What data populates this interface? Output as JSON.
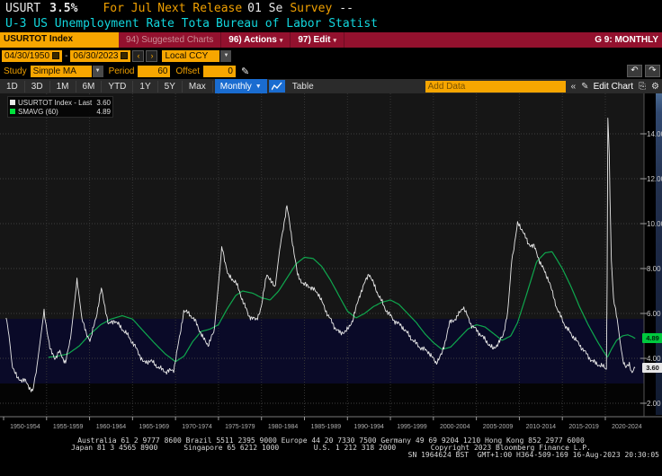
{
  "colors": {
    "amber": "#f7a600",
    "amber_text": "#f0a000",
    "redbar": "#93112e",
    "blue": "#1a6cd0",
    "cyan": "#12d7de",
    "green": "#0fa84e",
    "greenbadge": "#00c93e",
    "white_line": "#e8e8e8",
    "plot_bg": "#161616",
    "band_bg": "#0a0a28",
    "below_bg": "#040404",
    "grid": "#3f3f3f",
    "toolbar": "#2b2b2b"
  },
  "header": {
    "ticker": "USURT",
    "value": "3.5%",
    "for_label": "For Jul",
    "next_release_label": "Next Release",
    "next_release_value": "01 Se",
    "survey_label": "Survey",
    "survey_value": "--",
    "name": "U-3 US Unemployment Rate Tota",
    "source": "Bureau of Labor Statist"
  },
  "titlebar": {
    "security": "USURTOT Index",
    "suggested": "94) Suggested Charts",
    "actions": "96) Actions",
    "edit": "97) Edit",
    "right": "G 9: MONTHLY"
  },
  "controls": {
    "date_from": "04/30/1950",
    "date_sep": "-",
    "date_to": "06/30/2023",
    "prev": "‹",
    "next": "›",
    "ccy": "Local CCY",
    "study_label": "Study",
    "study_value": "Simple MA",
    "period_label": "Period",
    "period_value": "60",
    "offset_label": "Offset",
    "offset_value": "0",
    "undo": "↶",
    "redo": "↷"
  },
  "toolbar": {
    "tabs": [
      "1D",
      "3D",
      "1M",
      "6M",
      "YTD",
      "1Y",
      "5Y",
      "Max"
    ],
    "frequency": "Monthly",
    "table_label": "Table",
    "add_data": "Add Data",
    "collapse": "«",
    "edit_chart": "Edit Chart"
  },
  "legend": {
    "items": [
      {
        "label": "USURTOT Index - Last Price",
        "value": "3.60",
        "color": "#e8e8e8"
      },
      {
        "label": "SMAVG (60)",
        "value": "4.89",
        "color": "#00e13c"
      }
    ]
  },
  "badges": {
    "smavg": "4.89",
    "last": "3.60"
  },
  "footer": {
    "line1": "Australia 61 2 9777 8600 Brazil 5511 2395 9000 Europe 44 20 7330 7500 Germany 49 69 9204 1210 Hong Kong 852 2977 6000",
    "line2": "Japan 81 3 4565 8900      Singapore 65 6212 1000        U.S. 1 212 318 2000        Copyright 2023 Bloomberg Finance L.P.",
    "line3": "SN 1964624 BST  GMT+1:00 H364-509-169 16-Aug-2023 20:30:05"
  },
  "chart_data": {
    "type": "line",
    "x_range": [
      1950,
      2024.5
    ],
    "ylim": [
      1.4,
      15.8
    ],
    "y_ticks": [
      2,
      4,
      6,
      8,
      10,
      12,
      14
    ],
    "x_gridlines": [
      1955,
      1960,
      1965,
      1970,
      1975,
      1980,
      1985,
      1990,
      1995,
      2000,
      2005,
      2010,
      2015,
      2020
    ],
    "x_ticks": [
      1950,
      1955,
      1960,
      1965,
      1970,
      1975,
      1980,
      1985,
      1990,
      1995,
      2000,
      2005,
      2010,
      2015,
      2020
    ],
    "x_labels": [
      "1950-1954",
      "1955-1959",
      "1960-1964",
      "1965-1969",
      "1970-1974",
      "1975-1979",
      "1980-1984",
      "1985-1989",
      "1990-1994",
      "1995-1999",
      "2000-2004",
      "2005-2009",
      "2010-2014",
      "2015-2019",
      "2020-2024"
    ],
    "band": {
      "from": 2.88,
      "to": 5.76
    },
    "series": [
      {
        "name": "USURTOT Index - Last Price",
        "color": "#e8e8e8",
        "last_value": 3.6,
        "points": [
          [
            1950.29,
            5.8
          ],
          [
            1950.6,
            5.1
          ],
          [
            1951.0,
            3.7
          ],
          [
            1951.6,
            3.1
          ],
          [
            1952.5,
            3.0
          ],
          [
            1953.4,
            2.5
          ],
          [
            1953.9,
            3.7
          ],
          [
            1954.7,
            6.1
          ],
          [
            1955.4,
            4.4
          ],
          [
            1956.0,
            4.0
          ],
          [
            1956.5,
            4.3
          ],
          [
            1957.2,
            3.8
          ],
          [
            1957.8,
            4.9
          ],
          [
            1958.55,
            7.5
          ],
          [
            1959.1,
            5.8
          ],
          [
            1959.6,
            5.1
          ],
          [
            1960.1,
            4.8
          ],
          [
            1960.8,
            5.9
          ],
          [
            1961.37,
            7.1
          ],
          [
            1962.2,
            5.5
          ],
          [
            1962.9,
            5.7
          ],
          [
            1963.6,
            5.4
          ],
          [
            1964.5,
            5.0
          ],
          [
            1965.5,
            4.4
          ],
          [
            1966.3,
            3.8
          ],
          [
            1967.1,
            3.9
          ],
          [
            1968.0,
            3.6
          ],
          [
            1968.9,
            3.4
          ],
          [
            1969.8,
            3.5
          ],
          [
            1970.5,
            5.0
          ],
          [
            1970.95,
            6.1
          ],
          [
            1971.6,
            6.0
          ],
          [
            1972.4,
            5.6
          ],
          [
            1973.2,
            4.9
          ],
          [
            1973.8,
            4.6
          ],
          [
            1974.5,
            5.2
          ],
          [
            1975.4,
            9.0
          ],
          [
            1976.1,
            7.7
          ],
          [
            1977.0,
            7.4
          ],
          [
            1977.8,
            6.6
          ],
          [
            1978.5,
            5.9
          ],
          [
            1979.4,
            5.7
          ],
          [
            1980.0,
            6.3
          ],
          [
            1980.6,
            7.8
          ],
          [
            1981.1,
            7.4
          ],
          [
            1981.6,
            7.2
          ],
          [
            1982.1,
            8.8
          ],
          [
            1982.95,
            10.8
          ],
          [
            1983.6,
            9.2
          ],
          [
            1984.2,
            7.7
          ],
          [
            1984.9,
            7.3
          ],
          [
            1985.6,
            7.2
          ],
          [
            1986.6,
            6.9
          ],
          [
            1987.5,
            6.1
          ],
          [
            1988.5,
            5.4
          ],
          [
            1989.2,
            5.1
          ],
          [
            1990.1,
            5.3
          ],
          [
            1990.6,
            5.7
          ],
          [
            1991.5,
            6.9
          ],
          [
            1992.5,
            7.8
          ],
          [
            1993.4,
            7.0
          ],
          [
            1994.4,
            6.2
          ],
          [
            1995.4,
            5.7
          ],
          [
            1996.4,
            5.4
          ],
          [
            1997.4,
            4.9
          ],
          [
            1998.4,
            4.5
          ],
          [
            1999.4,
            4.3
          ],
          [
            2000.3,
            3.8
          ],
          [
            2001.0,
            4.2
          ],
          [
            2001.9,
            5.6
          ],
          [
            2002.7,
            5.8
          ],
          [
            2003.45,
            6.3
          ],
          [
            2004.4,
            5.5
          ],
          [
            2005.4,
            5.1
          ],
          [
            2006.3,
            4.7
          ],
          [
            2006.95,
            4.4
          ],
          [
            2007.6,
            4.7
          ],
          [
            2008.1,
            5.0
          ],
          [
            2008.65,
            6.1
          ],
          [
            2009.1,
            8.3
          ],
          [
            2009.8,
            10.0
          ],
          [
            2010.4,
            9.7
          ],
          [
            2011.0,
            9.1
          ],
          [
            2011.7,
            9.0
          ],
          [
            2012.5,
            8.2
          ],
          [
            2013.4,
            7.5
          ],
          [
            2014.4,
            6.2
          ],
          [
            2015.4,
            5.4
          ],
          [
            2016.4,
            4.9
          ],
          [
            2017.4,
            4.4
          ],
          [
            2018.4,
            3.9
          ],
          [
            2019.3,
            3.7
          ],
          [
            2019.9,
            3.6
          ],
          [
            2020.16,
            3.5
          ],
          [
            2020.29,
            14.7
          ],
          [
            2020.45,
            13.2
          ],
          [
            2020.54,
            11.1
          ],
          [
            2020.7,
            8.4
          ],
          [
            2020.95,
            6.7
          ],
          [
            2021.3,
            6.0
          ],
          [
            2021.7,
            4.8
          ],
          [
            2022.0,
            4.0
          ],
          [
            2022.4,
            3.6
          ],
          [
            2022.8,
            3.7
          ],
          [
            2023.05,
            3.4
          ],
          [
            2023.25,
            3.5
          ],
          [
            2023.45,
            3.6
          ]
        ]
      },
      {
        "name": "SMAVG (60)",
        "color": "#0fa84e",
        "last_value": 4.89,
        "points": [
          [
            1955.2,
            4.05
          ],
          [
            1956.3,
            4.1
          ],
          [
            1957.5,
            4.2
          ],
          [
            1958.8,
            4.55
          ],
          [
            1960.0,
            5.05
          ],
          [
            1961.3,
            5.5
          ],
          [
            1962.5,
            5.75
          ],
          [
            1963.8,
            5.9
          ],
          [
            1965.0,
            5.75
          ],
          [
            1966.3,
            5.2
          ],
          [
            1967.5,
            4.7
          ],
          [
            1968.8,
            4.2
          ],
          [
            1970.0,
            3.85
          ],
          [
            1971.0,
            4.1
          ],
          [
            1972.0,
            4.75
          ],
          [
            1973.0,
            5.2
          ],
          [
            1974.0,
            5.3
          ],
          [
            1975.0,
            5.5
          ],
          [
            1976.0,
            6.2
          ],
          [
            1977.0,
            6.8
          ],
          [
            1977.8,
            7.0
          ],
          [
            1979.0,
            6.9
          ],
          [
            1980.0,
            6.7
          ],
          [
            1981.0,
            6.6
          ],
          [
            1982.0,
            7.0
          ],
          [
            1983.0,
            7.6
          ],
          [
            1984.0,
            8.2
          ],
          [
            1985.0,
            8.5
          ],
          [
            1986.0,
            8.45
          ],
          [
            1987.0,
            8.1
          ],
          [
            1988.0,
            7.5
          ],
          [
            1989.0,
            6.8
          ],
          [
            1990.0,
            6.1
          ],
          [
            1991.0,
            5.8
          ],
          [
            1992.0,
            6.0
          ],
          [
            1993.0,
            6.3
          ],
          [
            1994.0,
            6.5
          ],
          [
            1995.0,
            6.6
          ],
          [
            1996.0,
            6.4
          ],
          [
            1997.0,
            6.0
          ],
          [
            1998.0,
            5.6
          ],
          [
            1999.0,
            5.1
          ],
          [
            2000.0,
            4.7
          ],
          [
            2001.0,
            4.4
          ],
          [
            2002.0,
            4.5
          ],
          [
            2003.0,
            4.9
          ],
          [
            2004.0,
            5.3
          ],
          [
            2005.0,
            5.5
          ],
          [
            2006.0,
            5.4
          ],
          [
            2007.0,
            5.1
          ],
          [
            2008.0,
            4.8
          ],
          [
            2009.0,
            5.0
          ],
          [
            2009.8,
            5.6
          ],
          [
            2010.8,
            6.8
          ],
          [
            2012.0,
            8.3
          ],
          [
            2013.0,
            8.7
          ],
          [
            2013.8,
            8.75
          ],
          [
            2015.0,
            8.0
          ],
          [
            2016.0,
            7.2
          ],
          [
            2017.0,
            6.3
          ],
          [
            2018.0,
            5.5
          ],
          [
            2019.0,
            4.8
          ],
          [
            2019.8,
            4.3
          ],
          [
            2020.25,
            4.05
          ],
          [
            2020.7,
            4.4
          ],
          [
            2021.3,
            4.8
          ],
          [
            2022.0,
            5.0
          ],
          [
            2022.6,
            5.05
          ],
          [
            2023.1,
            4.97
          ],
          [
            2023.45,
            4.89
          ]
        ]
      }
    ]
  }
}
